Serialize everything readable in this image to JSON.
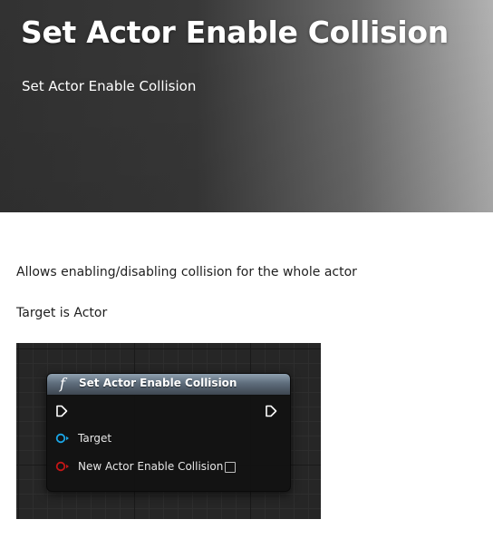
{
  "hero": {
    "title": "Set Actor Enable Collision",
    "subtitle": "Set Actor Enable Collision"
  },
  "content": {
    "description": "Allows enabling/disabling collision for the whole actor",
    "target_note": "Target is Actor"
  },
  "node": {
    "icon": "f",
    "title": "Set Actor Enable Collision",
    "pins": {
      "target_label": "Target",
      "enable_label": "New Actor Enable Collision"
    },
    "checkbox_checked": false
  },
  "colors": {
    "target_pin": "#1aa6e6",
    "bool_pin": "#c41616",
    "exec_pin": "#ffffff"
  },
  "icons": [
    "function-icon",
    "exec-pin-icon",
    "object-pin-icon",
    "bool-pin-icon",
    "checkbox-icon"
  ]
}
